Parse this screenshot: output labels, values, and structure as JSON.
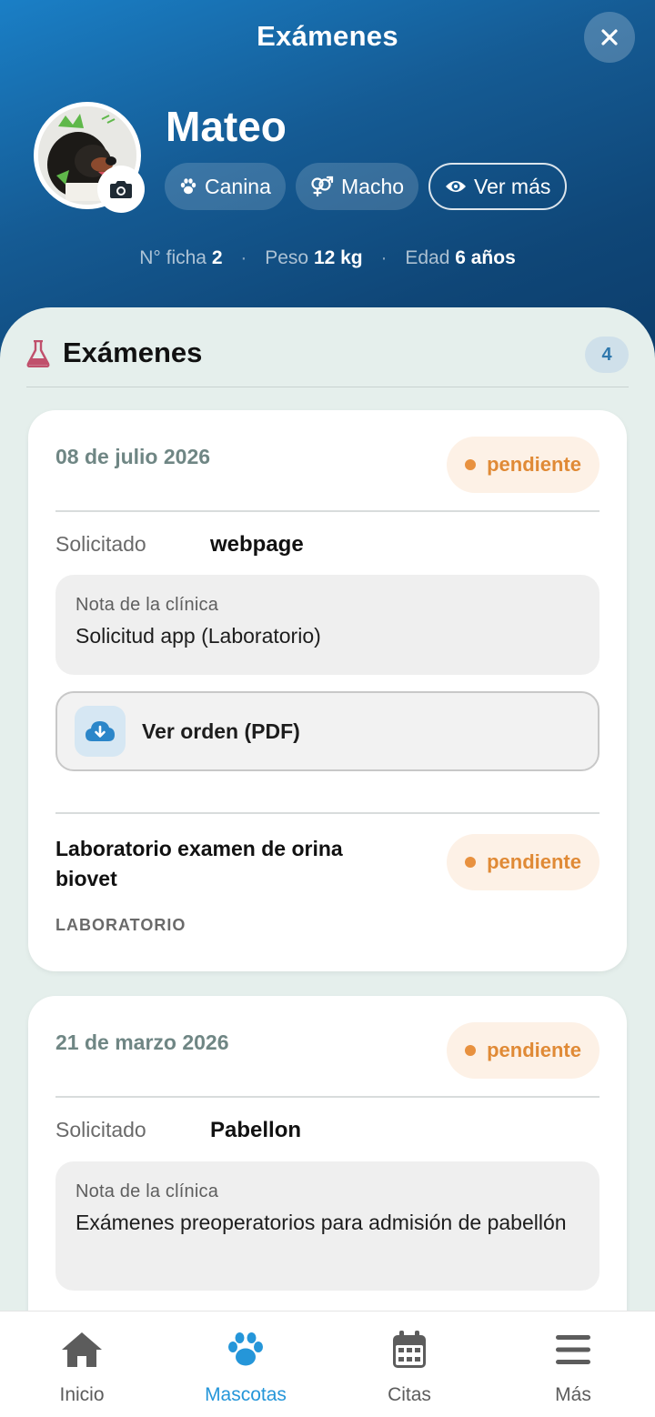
{
  "header": {
    "title": "Exámenes",
    "pet_name": "Mateo",
    "chips": {
      "species": "Canina",
      "sex": "Macho",
      "more": "Ver más"
    },
    "stats": {
      "ficha_label": "N° ficha",
      "ficha_value": "2",
      "peso_label": "Peso",
      "peso_value": "12 kg",
      "edad_label": "Edad",
      "edad_value": "6 años"
    }
  },
  "section": {
    "title": "Exámenes",
    "count": "4"
  },
  "cards": [
    {
      "date": "08 de julio 2026",
      "status": "pendiente",
      "requested_label": "Solicitado",
      "requested_value": "webpage",
      "note_label": "Nota de la clínica",
      "note_text": "Solicitud app (Laboratorio)",
      "pdf_label": "Ver orden (PDF)",
      "exam": {
        "name": "Laboratorio examen de orina biovet",
        "type": "LABORATORIO",
        "status": "pendiente"
      }
    },
    {
      "date": "21 de marzo 2026",
      "status": "pendiente",
      "requested_label": "Solicitado",
      "requested_value": "Pabellon",
      "note_label": "Nota de la clínica",
      "note_text": "Exámenes preoperatorios para admisión de pabellón"
    }
  ],
  "nav": [
    {
      "label": "Inicio",
      "icon": "home-icon"
    },
    {
      "label": "Mascotas",
      "icon": "paw-icon",
      "active": true
    },
    {
      "label": "Citas",
      "icon": "calendar-icon"
    },
    {
      "label": "Más",
      "icon": "menu-icon"
    }
  ],
  "colors": {
    "accent": "#2596d9",
    "status_pending": "#e08a36",
    "header_dark": "#0c3d6b",
    "header_light": "#1a7fc6"
  }
}
